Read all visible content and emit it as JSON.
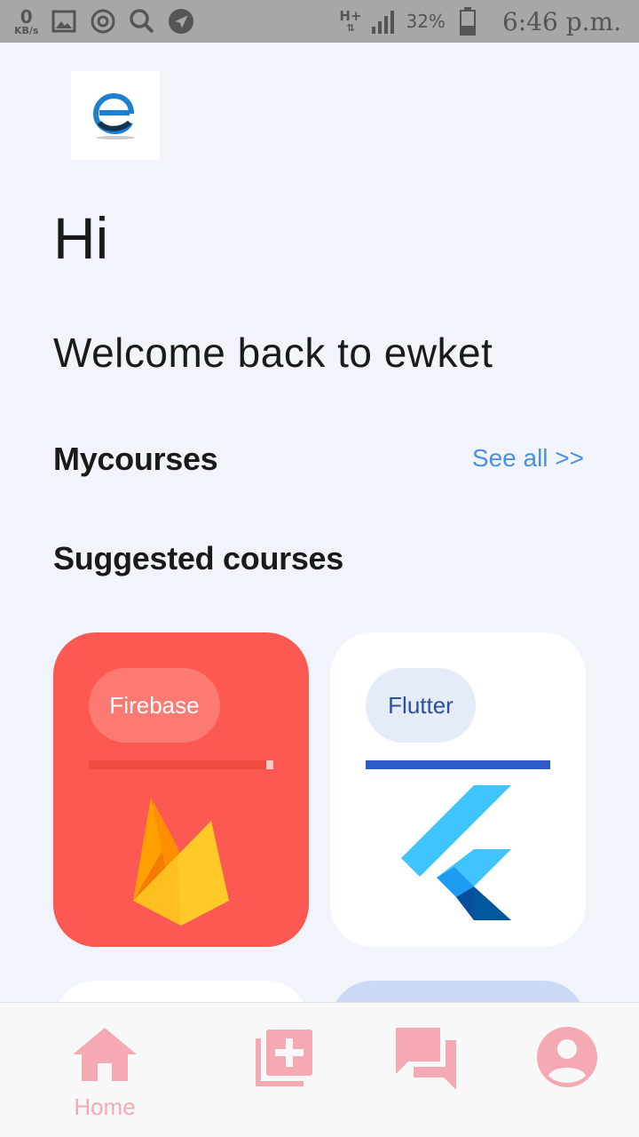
{
  "status_bar": {
    "speed_value": "0",
    "speed_unit": "KB/s",
    "network": "H+",
    "battery_percent": "32%",
    "time": "6:46 p.m.",
    "icons": [
      "image-icon",
      "sync-icon",
      "search-icon",
      "navigation-icon",
      "signal-icon",
      "battery-icon"
    ]
  },
  "header": {
    "logo": "ewket-logo",
    "greeting": "Hi",
    "welcome": "Welcome back to ewket"
  },
  "my_courses": {
    "title": "Mycourses",
    "see_all": "See all >>"
  },
  "suggested": {
    "title": "Suggested courses",
    "courses": [
      {
        "label": "Firebase",
        "icon": "firebase-icon",
        "color": "#fb5951"
      },
      {
        "label": "Flutter",
        "icon": "flutter-icon",
        "color": "#ffffff"
      }
    ]
  },
  "bottom_nav": {
    "items": [
      {
        "label": "Home",
        "icon": "home-icon",
        "active": true
      },
      {
        "label": "",
        "icon": "add-course-icon"
      },
      {
        "label": "",
        "icon": "chat-icon"
      },
      {
        "label": "",
        "icon": "profile-icon"
      }
    ],
    "accent": "#f4a9b3"
  }
}
